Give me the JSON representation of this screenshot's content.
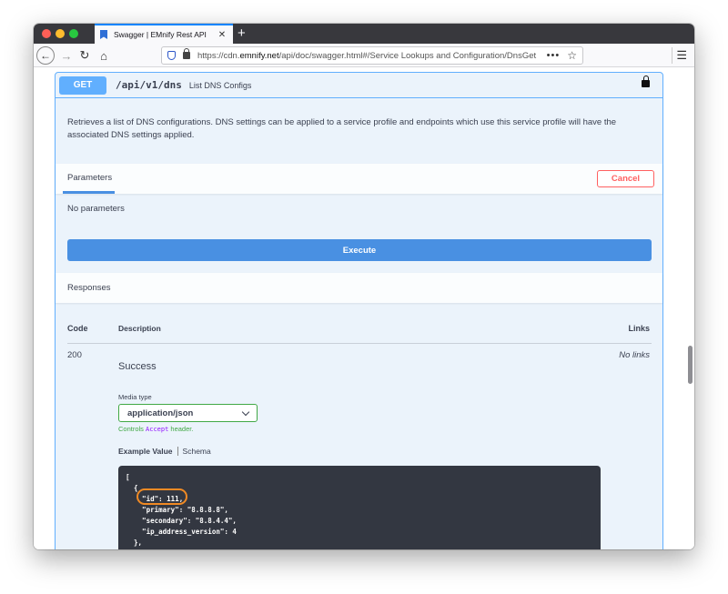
{
  "browser": {
    "tab_title": "Swagger | EMnify Rest API",
    "tab_close": "✕",
    "new_tab": "+",
    "url_prefix": "https://cdn.",
    "url_domain": "emnify.net",
    "url_path": "/api/doc/swagger.html#/Service Lookups and Configuration/DnsGet",
    "url_more": "•••",
    "icons": {
      "back": "←",
      "forward": "→",
      "reload": "↻",
      "home": "⌂",
      "star": "☆",
      "menu": "☰"
    }
  },
  "operation": {
    "method": "GET",
    "path": "/api/v1/dns",
    "summary": "List DNS Configs",
    "description": "Retrieves a list of DNS configurations. DNS settings can be applied to a service profile and endpoints which use this service profile will have the associated DNS settings applied.",
    "parameters_tab": "Parameters",
    "cancel_label": "Cancel",
    "no_parameters": "No parameters",
    "execute_label": "Execute",
    "responses_title": "Responses",
    "table_headers": {
      "code": "Code",
      "description": "Description",
      "links": "Links"
    },
    "response": {
      "code": "200",
      "description": "Success",
      "no_links": "No links",
      "media_type_label": "Media type",
      "media_type_value": "application/json",
      "controls_prefix": "Controls ",
      "controls_accent": "Accept",
      "controls_suffix": " header.",
      "example_tab": "Example Value",
      "schema_tab": "Schema",
      "example_lines": [
        "[",
        "  {",
        "    \"id\": 111,",
        "    \"primary\": \"8.8.8.8\",",
        "    \"secondary\": \"8.8.4.4\",",
        "    \"ip_address_version\": 4",
        "  },"
      ]
    }
  },
  "colors": {
    "get_accent": "#61affe",
    "execute": "#4990e2",
    "cancel": "#ff6060",
    "media_border": "#41a845",
    "highlight": "#f08a24"
  }
}
